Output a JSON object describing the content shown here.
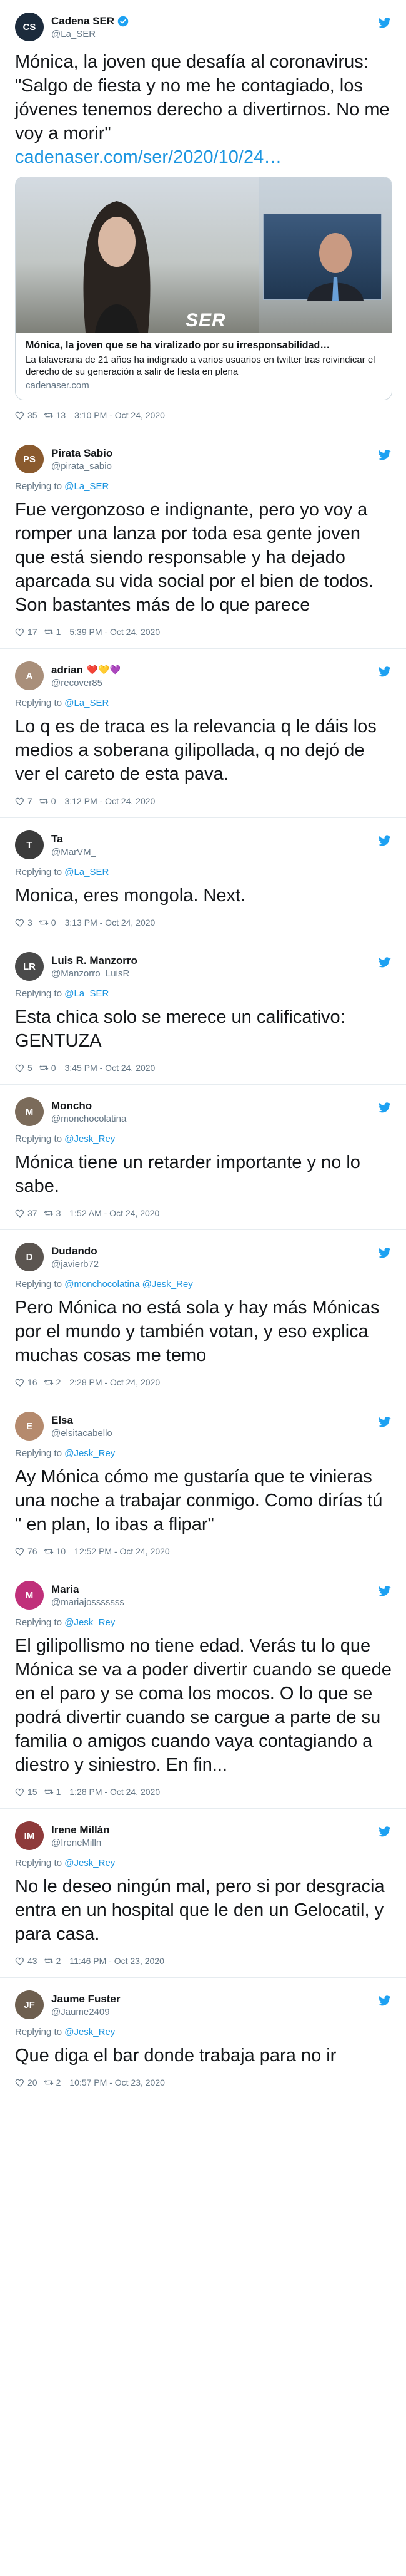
{
  "tweets": [
    {
      "name": "Cadena SER",
      "handle": "@La_SER",
      "verified": true,
      "text": "Mónica, la joven que desafía al coronavirus: \"Salgo de fiesta y no me he contagiado, los jóvenes tenemos derecho a divertirnos. No me voy a morir\"",
      "link": "cadenaser.com/ser/2020/10/24…",
      "card": {
        "title": "Mónica, la joven que se ha viralizado por su irresponsabilidad…",
        "description": "La talaverana de 21 años ha indignado a varios usuarios en twitter tras reivindicar el derecho de su generación a salir de fiesta en plena",
        "domain": "cadenaser.com",
        "image_logo": "SER"
      },
      "likes": "35",
      "retweets": "13",
      "time": "3:10 PM - Oct 24, 2020"
    },
    {
      "name": "Pirata Sabio",
      "handle": "@pirata_sabio",
      "reply_to": "@La_SER",
      "text": "Fue vergonzoso e indignante, pero yo voy a romper una lanza por toda esa gente joven que está siendo responsable y ha dejado aparcada su vida social por el bien de todos. Son bastantes más de lo que parece",
      "likes": "17",
      "retweets": "1",
      "time": "5:39 PM - Oct 24, 2020"
    },
    {
      "name": "adrian",
      "emojis": "❤️💛💜",
      "handle": "@recover85",
      "reply_to": "@La_SER",
      "text": "Lo q es de traca es la relevancia q le dáis los medios a soberana gilipollada, q no dejó de ver el careto de esta pava.",
      "likes": "7",
      "retweets": "0",
      "time": "3:12 PM - Oct 24, 2020"
    },
    {
      "name": "Ta",
      "handle": "@MarVM_",
      "reply_to": "@La_SER",
      "text": "Monica, eres mongola. Next.",
      "likes": "3",
      "retweets": "0",
      "time": "3:13 PM - Oct 24, 2020"
    },
    {
      "name": "Luis R. Manzorro",
      "handle": "@Manzorro_LuisR",
      "reply_to": "@La_SER",
      "text": "Esta chica solo se merece un calificativo: GENTUZA",
      "likes": "5",
      "retweets": "0",
      "time": "3:45 PM - Oct 24, 2020"
    },
    {
      "name": "Moncho",
      "handle": "@monchocolatina",
      "reply_to": "@Jesk_Rey",
      "text": "Mónica tiene un retarder importante y no lo sabe.",
      "likes": "37",
      "retweets": "3",
      "time": "1:52 AM - Oct 24, 2020"
    },
    {
      "name": "Dudando",
      "handle": "@javierb72",
      "reply_to": "@monchocolatina @Jesk_Rey",
      "text": "Pero Mónica no está sola y hay más Mónicas por el mundo y también votan, y eso explica muchas cosas me temo",
      "likes": "16",
      "retweets": "2",
      "time": "2:28 PM - Oct 24, 2020"
    },
    {
      "name": "Elsa",
      "handle": "@elsitacabello",
      "reply_to": "@Jesk_Rey",
      "text": "Ay Mónica cómo me gustaría que te vinieras una noche a trabajar conmigo. Como dirías tú \" en plan, lo ibas a flipar\"",
      "likes": "76",
      "retweets": "10",
      "time": "12:52 PM - Oct 24, 2020"
    },
    {
      "name": "Maria",
      "handle": "@mariajosssssss",
      "reply_to": "@Jesk_Rey",
      "text": "El gilipollismo no tiene edad. Verás tu lo que Mónica se va a poder divertir cuando se quede en el paro y se coma los mocos. O lo que se podrá divertir cuando se cargue a parte de su familia o amigos cuando vaya contagiando a diestro y siniestro. En fin...",
      "likes": "15",
      "retweets": "1",
      "time": "1:28 PM - Oct 24, 2020"
    },
    {
      "name": "Irene Millán",
      "handle": "@IreneMilln",
      "reply_to": "@Jesk_Rey",
      "text": "No le deseo ningún mal, pero si por desgracia entra en un hospital que le den un Gelocatil, y para casa.",
      "likes": "43",
      "retweets": "2",
      "time": "11:46 PM - Oct 23, 2020"
    },
    {
      "name": "Jaume Fuster",
      "handle": "@Jaume2409",
      "reply_to": "@Jesk_Rey",
      "text": "Que diga el bar donde trabaja para no ir",
      "likes": "20",
      "retweets": "2",
      "time": "10:57 PM - Oct 23, 2020"
    }
  ],
  "labels": {
    "replying_to": "Replying to"
  },
  "colors": {
    "link": "#1b95e0",
    "muted": "#657786",
    "text": "#14171a",
    "border": "#e6ecf0"
  },
  "avatar_colors": [
    "#1c2b3c",
    "#8a5a2e",
    "#a98f7a",
    "#3b3b3b",
    "#4a4a4a",
    "#7b6b5a",
    "#5b5550",
    "#b58a6d",
    "#c0307a",
    "#8e3a3a",
    "#6e5f4f"
  ],
  "icons": {
    "verified": "verified-badge-icon",
    "bird": "twitter-bird-icon",
    "like": "heart-icon",
    "retweet": "retweet-icon"
  }
}
